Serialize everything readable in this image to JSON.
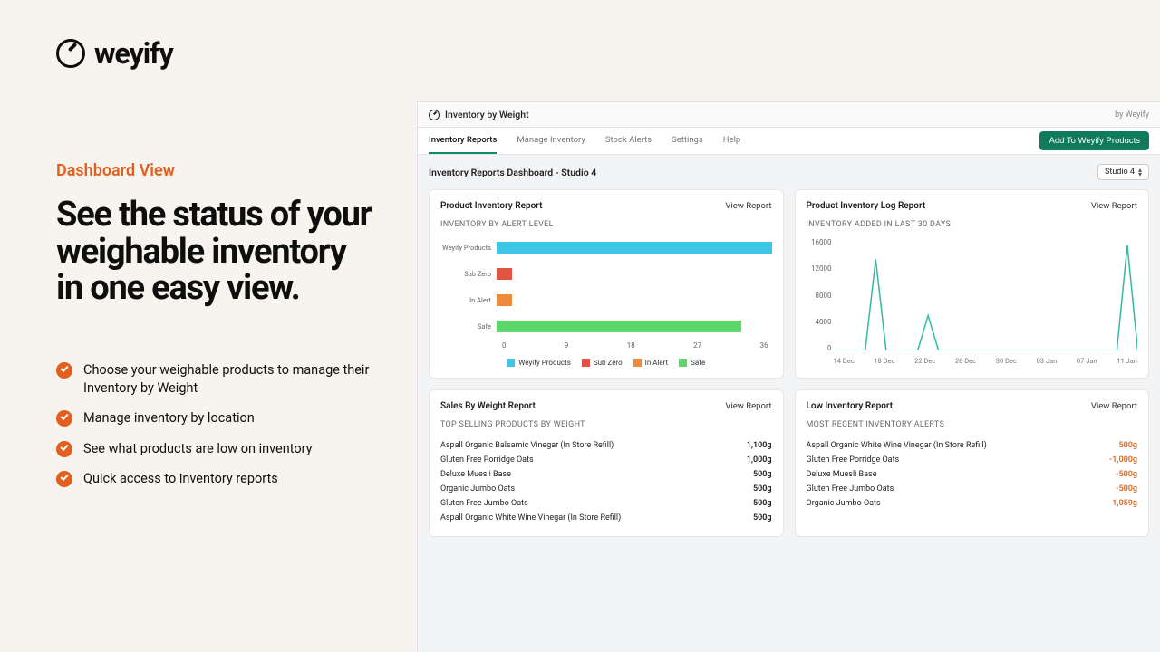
{
  "brand": "weyify",
  "eyebrow": "Dashboard View",
  "headline": "See the status of your weighable inventory in one easy view.",
  "bullets": [
    "Choose your weighable products to manage their Inventory by Weight",
    "Manage inventory by location",
    "See what products are low on inventory",
    "Quick access to inventory reports"
  ],
  "app": {
    "title": "Inventory by Weight",
    "credit": "by Weyify",
    "tabs": [
      "Inventory Reports",
      "Manage Inventory",
      "Stock Alerts",
      "Settings",
      "Help"
    ],
    "cta": "Add To Weyify Products",
    "dash_title": "Inventory Reports Dashboard - Studio 4",
    "location": "Studio 4",
    "view_report": "View Report",
    "card1": {
      "title": "Product Inventory Report",
      "section": "INVENTORY BY ALERT LEVEL"
    },
    "card2": {
      "title": "Product Inventory Log Report",
      "section": "INVENTORY ADDED IN LAST 30 DAYS"
    },
    "card3": {
      "title": "Sales By Weight Report",
      "section": "TOP SELLING PRODUCTS BY WEIGHT",
      "rows": [
        {
          "name": "Aspall Organic Balsamic Vinegar (In Store Refill)",
          "val": "1,100g"
        },
        {
          "name": "Gluten Free Porridge Oats",
          "val": "1,000g"
        },
        {
          "name": "Deluxe Muesli Base",
          "val": "500g"
        },
        {
          "name": "Organic Jumbo Oats",
          "val": "500g"
        },
        {
          "name": "Gluten Free Jumbo Oats",
          "val": "500g"
        },
        {
          "name": "Aspall Organic White Wine Vinegar (In Store Refill)",
          "val": "500g"
        }
      ]
    },
    "card4": {
      "title": "Low Inventory Report",
      "section": "MOST RECENT INVENTORY ALERTS",
      "rows": [
        {
          "name": "Aspall Organic White Wine Vinegar (In Store Refill)",
          "val": "500g",
          "neg": true
        },
        {
          "name": "Gluten Free Porridge Oats",
          "val": "-1,000g",
          "neg": true
        },
        {
          "name": "Deluxe Muesli Base",
          "val": "-500g",
          "neg": true
        },
        {
          "name": "Gluten Free Jumbo Oats",
          "val": "-500g",
          "neg": true
        },
        {
          "name": "Organic Jumbo Oats",
          "val": "1,059g",
          "neg": true
        }
      ]
    }
  },
  "colors": {
    "cyan": "#3fc5e6",
    "red": "#e35344",
    "orange": "#ef8a3a",
    "green": "#5ad769",
    "teal": "#2fb9a0"
  },
  "chart_data": [
    {
      "type": "bar",
      "title": "INVENTORY BY ALERT LEVEL",
      "orientation": "horizontal",
      "categories": [
        "Weyify Products",
        "Sub Zero",
        "In Alert",
        "Safe"
      ],
      "values": [
        36,
        2,
        2,
        32
      ],
      "colors": [
        "#3fc5e6",
        "#e35344",
        "#ef8a3a",
        "#5ad769"
      ],
      "xlim": [
        0,
        36
      ],
      "xticks": [
        0,
        9,
        18,
        27,
        36
      ],
      "legend": [
        "Weyify Products",
        "Sub Zero",
        "In Alert",
        "Safe"
      ]
    },
    {
      "type": "line",
      "title": "INVENTORY ADDED IN LAST 30 DAYS",
      "x": [
        "14 Dec",
        "15 Dec",
        "16 Dec",
        "17 Dec",
        "18 Dec",
        "19 Dec",
        "20 Dec",
        "21 Dec",
        "22 Dec",
        "23 Dec",
        "24 Dec",
        "25 Dec",
        "26 Dec",
        "27 Dec",
        "28 Dec",
        "29 Dec",
        "30 Dec",
        "31 Dec",
        "01 Jan",
        "02 Jan",
        "03 Jan",
        "04 Jan",
        "05 Jan",
        "06 Jan",
        "07 Jan",
        "08 Jan",
        "09 Jan",
        "10 Jan",
        "11 Jan",
        "12 Jan"
      ],
      "xticks": [
        "14 Dec",
        "18 Dec",
        "22 Dec",
        "26 Dec",
        "30 Dec",
        "03 Jan",
        "07 Jan",
        "11 Jan"
      ],
      "values": [
        0,
        0,
        0,
        0,
        13000,
        0,
        0,
        0,
        0,
        5000,
        0,
        0,
        0,
        0,
        0,
        0,
        0,
        0,
        0,
        0,
        0,
        0,
        0,
        0,
        0,
        0,
        0,
        0,
        15000,
        0
      ],
      "ylim": [
        0,
        16000
      ],
      "yticks": [
        0,
        4000,
        8000,
        12000,
        16000
      ],
      "color": "#2fb9a0"
    }
  ]
}
